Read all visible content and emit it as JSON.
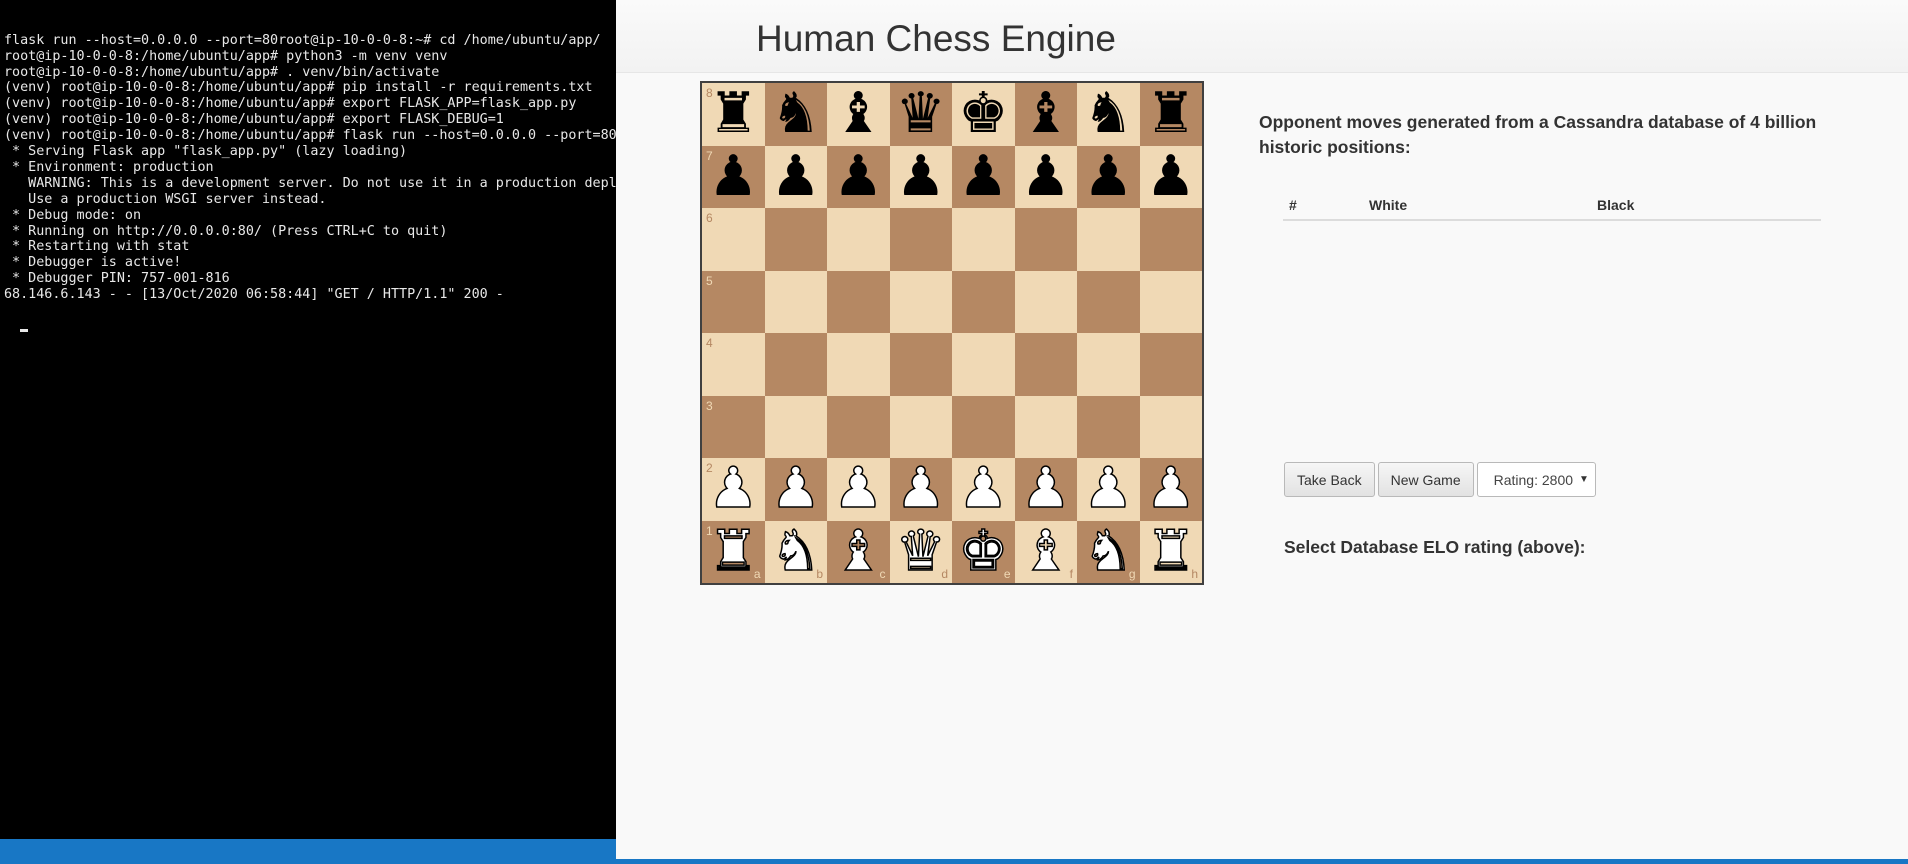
{
  "terminal": {
    "lines": [
      "flask run --host=0.0.0.0 --port=80root@ip-10-0-0-8:~# cd /home/ubuntu/app/",
      "root@ip-10-0-0-8:/home/ubuntu/app# python3 -m venv venv",
      "root@ip-10-0-0-8:/home/ubuntu/app# . venv/bin/activate",
      "(venv) root@ip-10-0-0-8:/home/ubuntu/app# pip install -r requirements.txt",
      "(venv) root@ip-10-0-0-8:/home/ubuntu/app# export FLASK_APP=flask_app.py",
      "(venv) root@ip-10-0-0-8:/home/ubuntu/app# export FLASK_DEBUG=1",
      "(venv) root@ip-10-0-0-8:/home/ubuntu/app# flask run --host=0.0.0.0 --port=80",
      " * Serving Flask app \"flask_app.py\" (lazy loading)",
      " * Environment: production",
      "   WARNING: This is a development server. Do not use it in a production deplo",
      "   Use a production WSGI server instead.",
      " * Debug mode: on",
      " * Running on http://0.0.0.0:80/ (Press CTRL+C to quit)",
      " * Restarting with stat",
      " * Debugger is active!",
      " * Debugger PIN: 757-001-816",
      "68.146.6.143 - - [13/Oct/2020 06:58:44] \"GET / HTTP/1.1\" 200 -"
    ]
  },
  "page": {
    "title": "Human Chess Engine",
    "description": "Opponent moves generated from a Cassandra database of 4 billion historic positions:",
    "moves_table": {
      "col_num": "#",
      "col_white": "White",
      "col_black": "Black"
    },
    "buttons": {
      "take_back": "Take Back",
      "new_game": "New Game"
    },
    "rating_select": {
      "value": "Rating: 2800"
    },
    "elo_label": "Select Database ELO rating (above):"
  },
  "board": {
    "ranks": [
      "8",
      "7",
      "6",
      "5",
      "4",
      "3",
      "2",
      "1"
    ],
    "files": [
      "a",
      "b",
      "c",
      "d",
      "e",
      "f",
      "g",
      "h"
    ],
    "rows": [
      [
        "br",
        "bn",
        "bb",
        "bq",
        "bk",
        "bb",
        "bn",
        "br"
      ],
      [
        "bp",
        "bp",
        "bp",
        "bp",
        "bp",
        "bp",
        "bp",
        "bp"
      ],
      [
        "",
        "",
        "",
        "",
        "",
        "",
        "",
        ""
      ],
      [
        "",
        "",
        "",
        "",
        "",
        "",
        "",
        ""
      ],
      [
        "",
        "",
        "",
        "",
        "",
        "",
        "",
        ""
      ],
      [
        "",
        "",
        "",
        "",
        "",
        "",
        "",
        ""
      ],
      [
        "wp",
        "wp",
        "wp",
        "wp",
        "wp",
        "wp",
        "wp",
        "wp"
      ],
      [
        "wr",
        "wn",
        "wb",
        "wq",
        "wk",
        "wb",
        "wn",
        "wr"
      ]
    ],
    "colors": {
      "light": "#f0d9b5",
      "dark": "#b58863"
    }
  }
}
